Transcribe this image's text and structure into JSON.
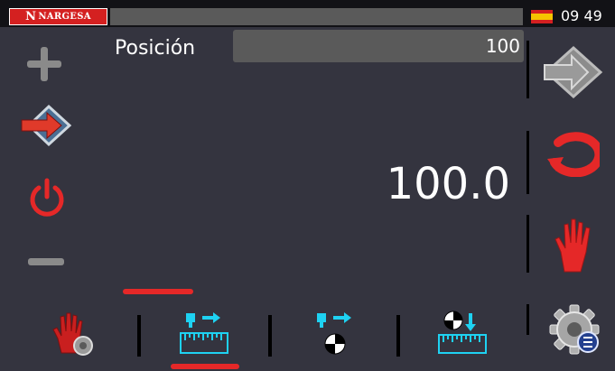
{
  "header": {
    "logo_mark": "N",
    "logo_text": "NARGESA",
    "clock": "09 49",
    "language_flag": "spain-flag-icon"
  },
  "position": {
    "label": "Posición",
    "value": "100"
  },
  "display": {
    "current_value": "100.0"
  },
  "left_toolbar": [
    "plus-icon",
    "send-arrow-icon",
    "power-icon",
    "minus-icon"
  ],
  "right_toolbar": [
    "arrow-right-diamond-icon",
    "cycle-icon",
    "hand-stop-icon"
  ],
  "bottom_tabs": [
    {
      "icon": "manual-settings-icon",
      "active": false
    },
    {
      "icon": "measure-move-icon",
      "active": true
    },
    {
      "icon": "move-to-reference-icon",
      "active": false
    },
    {
      "icon": "reference-measure-icon",
      "active": false
    }
  ],
  "settings_button": "settings-list-icon",
  "colors": {
    "background": "#34343f",
    "accent_red": "#e52828",
    "cyan": "#1ed2f2",
    "field": "#5a5a5a"
  }
}
